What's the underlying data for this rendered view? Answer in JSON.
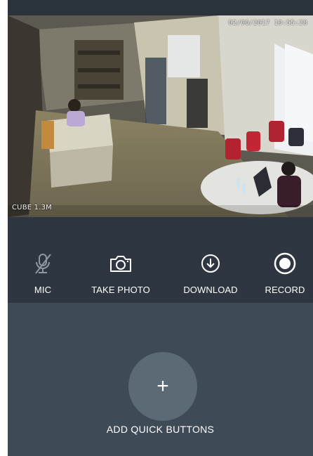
{
  "video": {
    "timestamp": "02/06/2017 10:55:28",
    "camera_name": "CUBE 1.3M"
  },
  "controls": [
    {
      "label": "MIC",
      "icon": "mic-muted-icon"
    },
    {
      "label": "TAKE PHOTO",
      "icon": "camera-icon"
    },
    {
      "label": "DOWNLOAD",
      "icon": "download-icon"
    },
    {
      "label": "RECORD",
      "icon": "record-icon"
    }
  ],
  "quick_buttons": {
    "add_symbol": "+",
    "label": "ADD QUICK BUTTONS"
  },
  "colors": {
    "background": "#3f4a57",
    "controls_bar": "#2e3741",
    "add_button": "#5c6a76",
    "text": "#ffffff"
  }
}
